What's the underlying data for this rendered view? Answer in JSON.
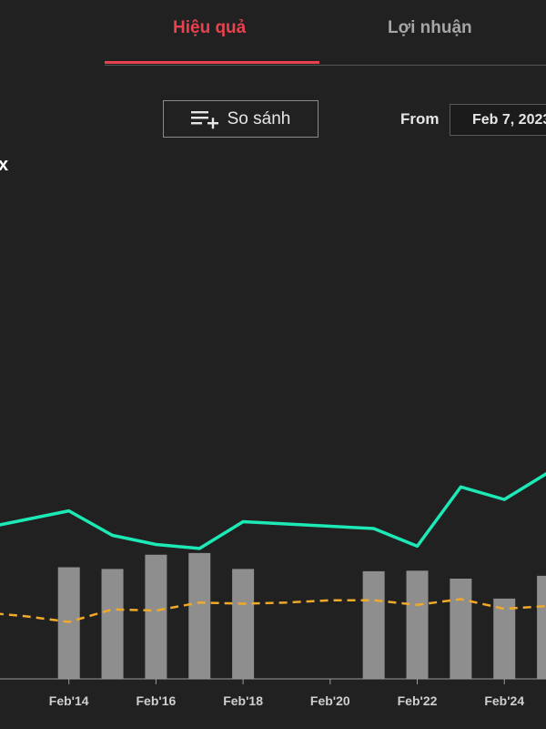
{
  "tabs": {
    "performance": "Hiệu quả",
    "profit": "Lợi nhuận"
  },
  "toolbar": {
    "compare_label": "So sánh",
    "from_label": "From",
    "from_value": "Feb 7, 2023"
  },
  "header": {
    "clipped_text": "x"
  },
  "colors": {
    "accent": "#e8414f",
    "line_series": "#1de9b6",
    "dashed_series": "#f0a92a",
    "bars": "#8e8e8e",
    "background": "#212121"
  },
  "icons": {
    "compare": "playlist-add-icon"
  },
  "chart_data": {
    "type": "line",
    "x_ticks": [
      "Feb'14",
      "Feb'16",
      "Feb'18",
      "Feb'20",
      "Feb'22",
      "Feb'24"
    ],
    "x_tick_values": [
      14,
      16,
      18,
      20,
      22,
      24
    ],
    "x_range": [
      12,
      25.5
    ],
    "y_range": [
      0,
      100
    ],
    "series": [
      {
        "style": "solid",
        "x": [
          12,
          14,
          15,
          16,
          17,
          18,
          21,
          22,
          23,
          24,
          25,
          25.5
        ],
        "values": [
          26.4,
          29.5,
          25.2,
          23.6,
          22.9,
          27.6,
          26.4,
          23.3,
          33.7,
          31.5,
          36.2,
          38.0
        ]
      },
      {
        "style": "dashed",
        "x": [
          12,
          13,
          14,
          15,
          16,
          17,
          18,
          19,
          20,
          21,
          22,
          23,
          24,
          25,
          25.5
        ],
        "values": [
          11.7,
          11.0,
          10.0,
          12.2,
          12.0,
          13.4,
          13.2,
          13.4,
          13.8,
          13.8,
          13.0,
          14.0,
          12.3,
          12.8,
          12.6
        ]
      },
      {
        "style": "bars",
        "x": [
          14,
          15,
          16,
          17,
          18,
          21,
          22,
          23,
          24,
          25,
          25.5
        ],
        "values": [
          19.6,
          19.3,
          21.8,
          22.1,
          19.3,
          18.9,
          19.0,
          17.6,
          14.1,
          18.1,
          18.1
        ]
      }
    ],
    "grid": false
  }
}
